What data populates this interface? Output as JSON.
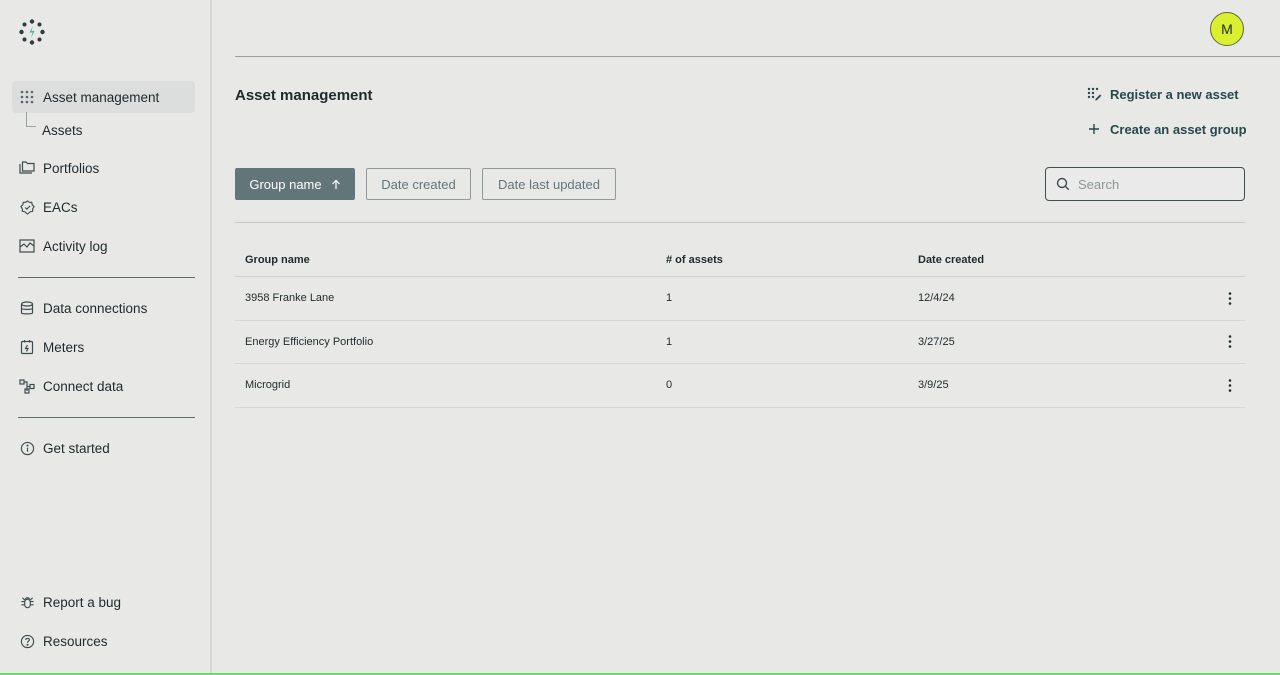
{
  "sidebar": {
    "items": [
      {
        "label": "Asset management",
        "icon": "grid-dots-icon"
      },
      {
        "label": "Assets",
        "icon": ""
      },
      {
        "label": "Portfolios",
        "icon": "folders-icon"
      },
      {
        "label": "EACs",
        "icon": "badge-check-icon"
      },
      {
        "label": "Activity log",
        "icon": "activity-chart-icon"
      },
      {
        "label": "Data connections",
        "icon": "database-icon"
      },
      {
        "label": "Meters",
        "icon": "meter-icon"
      },
      {
        "label": "Connect data",
        "icon": "connect-nodes-icon"
      },
      {
        "label": "Get started",
        "icon": "info-icon"
      },
      {
        "label": "Report a bug",
        "icon": "bug-icon"
      },
      {
        "label": "Resources",
        "icon": "help-icon"
      }
    ]
  },
  "header": {
    "avatar_initial": "M"
  },
  "main": {
    "title": "Asset management",
    "register_label": "Register a new asset",
    "create_group_label": "Create an asset group",
    "sort_buttons": [
      "Group name",
      "Date created",
      "Date last updated"
    ],
    "search_placeholder": "Search",
    "table": {
      "headers": [
        "Group name",
        "# of assets",
        "Date created"
      ],
      "rows": [
        {
          "name": "3958 Franke Lane",
          "assets": "1",
          "date": "12/4/24"
        },
        {
          "name": "Energy Efficiency Portfolio",
          "assets": "1",
          "date": "3/27/25"
        },
        {
          "name": "Microgrid",
          "assets": "0",
          "date": "3/9/25"
        }
      ]
    }
  },
  "colors": {
    "accent": "#627579",
    "avatar": "#d9ef2f",
    "link": "#27494b",
    "logo_teal": "#3fb6a8"
  }
}
